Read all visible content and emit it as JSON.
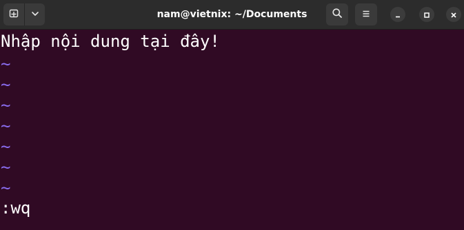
{
  "window": {
    "title": "nam@vietnix: ~/Documents"
  },
  "icons": {
    "new_tab": "new-tab-icon",
    "dropdown": "chevron-down-icon",
    "search": "search-icon",
    "menu": "hamburger-menu-icon",
    "minimize": "minimize-icon",
    "maximize": "maximize-icon",
    "close": "close-icon"
  },
  "colors": {
    "terminal_bg": "#300a24",
    "titlebar_bg": "#2c2c2c",
    "text": "#ffffff",
    "tilde": "#8a6df0"
  },
  "editor": {
    "content_line": "Nhập nội dung tại đây!",
    "empty_marker": "~",
    "command_line": ":wq"
  }
}
